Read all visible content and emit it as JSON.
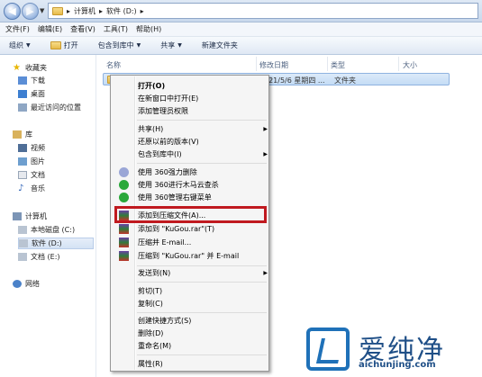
{
  "address": {
    "path": [
      "计算机",
      "软件 (D:)"
    ],
    "separator": "▸"
  },
  "menubar": [
    "文件(F)",
    "编辑(E)",
    "查看(V)",
    "工具(T)",
    "帮助(H)"
  ],
  "toolbar": {
    "organize": "组织",
    "open": "打开",
    "include": "包含到库中",
    "share": "共享",
    "new_folder": "新建文件夹"
  },
  "nav": {
    "favorites": "收藏夹",
    "downloads": "下载",
    "desktop": "桌面",
    "recent": "最近访问的位置",
    "libraries": "库",
    "videos": "视频",
    "pictures": "图片",
    "documents": "文档",
    "music": "音乐",
    "computer": "计算机",
    "drive_c": "本地磁盘 (C:)",
    "drive_d": "软件 (D:)",
    "drive_e": "文档 (E:)",
    "network": "网络"
  },
  "columns": {
    "name": "名称",
    "modified": "修改日期",
    "type": "类型",
    "size": "大小"
  },
  "file": {
    "date_partial": "021/5/6 星期四 ...",
    "type": "文件夹"
  },
  "context_menu": {
    "open": "打开(O)",
    "open_new_window": "在新窗口中打开(E)",
    "add_admin": "添加管理员权限",
    "share": "共享(H)",
    "restore": "还原以前的版本(V)",
    "include": "包含到库中(I)",
    "force_delete": "使用 360强力删除",
    "trojan_scan": "使用 360进行木马云查杀",
    "manage_menu": "使用 360管理右键菜单",
    "add_archive": "添加到压缩文件(A)...",
    "add_to_rar": "添加到 \"KuGou.rar\"(T)",
    "compress_email": "压缩并 E-mail...",
    "compress_rar_email": "压缩到 \"KuGou.rar\" 并 E-mail",
    "send_to": "发送到(N)",
    "cut": "剪切(T)",
    "copy": "复制(C)",
    "create_shortcut": "创建快捷方式(S)",
    "delete": "删除(D)",
    "rename": "重命名(M)",
    "properties": "属性(R)"
  },
  "watermark": {
    "text": "爱纯净",
    "url": "aichunjing.com"
  }
}
